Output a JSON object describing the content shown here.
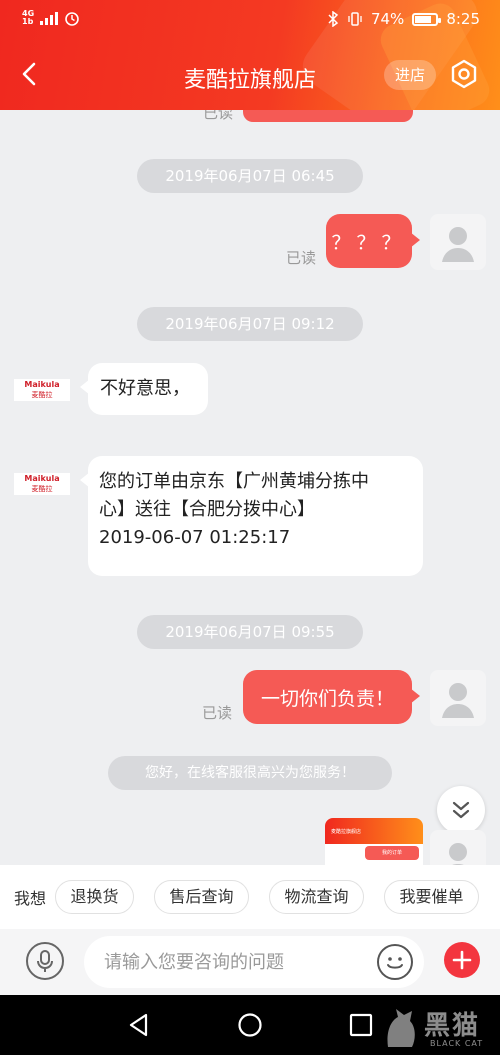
{
  "status_bar": {
    "network": "4G",
    "network_sub": "1b",
    "battery": "74%",
    "time": "8:25"
  },
  "header": {
    "title": "麦酷拉旗舰店",
    "enter_store": "进店"
  },
  "chat": {
    "top_read": "已读",
    "groups": [
      {
        "timestamp": "2019年06月07日  06:45"
      },
      {
        "timestamp": "2019年06月07日  09:12"
      },
      {
        "timestamp": "2019年06月07日  09:55"
      }
    ],
    "msg_q": {
      "text": "？？？",
      "status": "已读"
    },
    "msg_sorry": {
      "text": "不好意思，"
    },
    "msg_order": {
      "lines": [
        "您的订单由京东【广州黄埔分拣中",
        "心】送往【合肥分拨中心】",
        "2019-06-07  01:25:17"
      ]
    },
    "msg_responsible": {
      "text": "一切你们负责！",
      "status": "已读"
    },
    "system_tip": "您好，在线客服很高兴为您服务！",
    "shop_avatar": {
      "brand": "Maikula",
      "brand_cn": "麦酷拉"
    },
    "card_preview": {
      "caption": "麦酷拉旗舰店",
      "button": "我的订单"
    }
  },
  "quick_replies": {
    "label": "我想",
    "items": [
      "退换货",
      "售后查询",
      "物流查询",
      "我要催单"
    ]
  },
  "input": {
    "placeholder": "请输入您要咨询的问题"
  },
  "watermark": {
    "cn": "黑猫",
    "en": "BLACK CAT"
  },
  "colors": {
    "brand_red": "#f0281f",
    "bubble_red": "#f55a55",
    "plus_red": "#f3353f"
  }
}
